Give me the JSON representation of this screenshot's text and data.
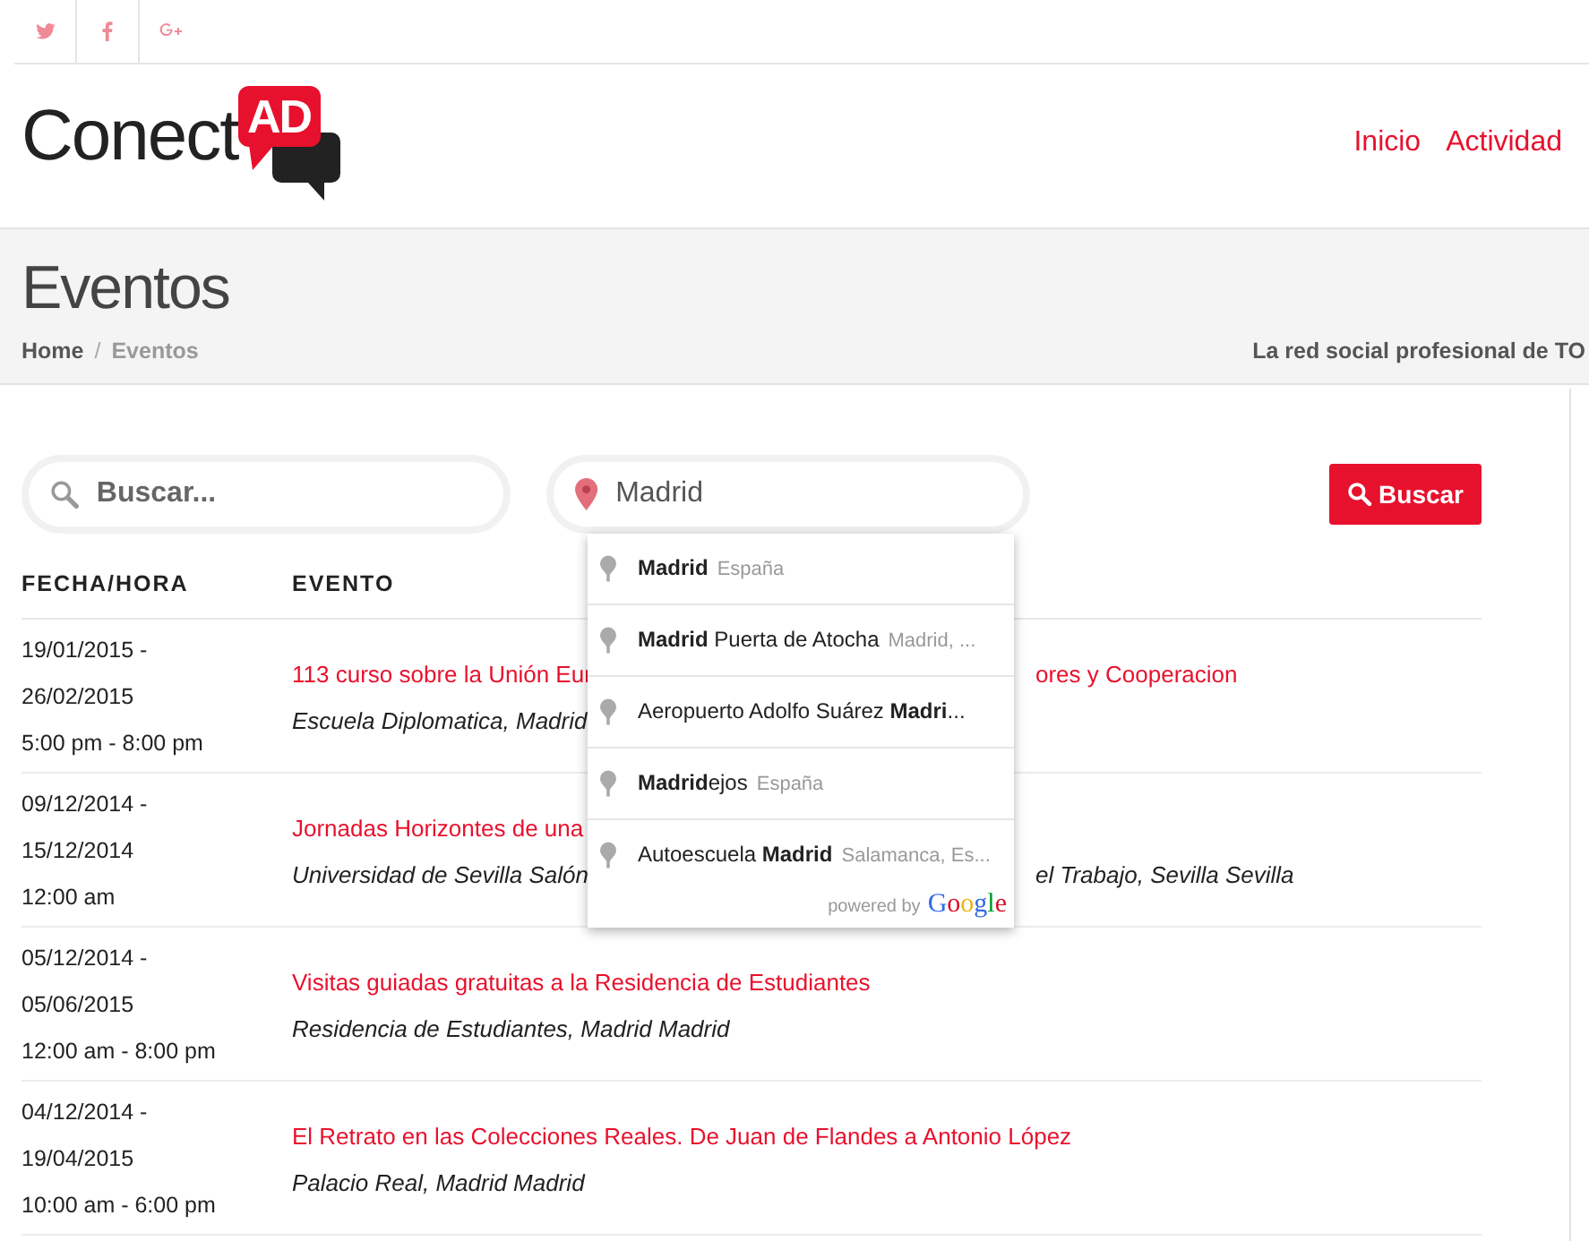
{
  "social": [
    {
      "kind": "twitter"
    },
    {
      "kind": "facebook"
    },
    {
      "kind": "googleplus"
    }
  ],
  "logo": {
    "text": "Conect",
    "badge": "AD"
  },
  "nav": [
    "Inicio",
    "Actividad"
  ],
  "page": {
    "title": "Eventos",
    "breadcrumb": [
      "Home",
      "Eventos"
    ],
    "breadcrumb_separator": "/",
    "tagline": "La red social profesional de TO"
  },
  "search": {
    "keyword_placeholder": "Buscar...",
    "location_value": "Madrid",
    "button": "Buscar"
  },
  "autocomplete": {
    "items": [
      {
        "main": "**Madrid**",
        "secondary": "España"
      },
      {
        "main": "**Madrid** Puerta de Atocha",
        "secondary": "Madrid, ..."
      },
      {
        "main": "Aeropuerto Adolfo Suárez **Madri**..."
      },
      {
        "main": "**Madrid**ejos",
        "secondary": "España"
      },
      {
        "main": "Autoescuela **Madrid**",
        "secondary": "Salamanca, Es..."
      }
    ],
    "powered_by": "powered by",
    "brand": "Google"
  },
  "table": {
    "columns": [
      "FECHA/HORA",
      "EVENTO"
    ],
    "rows": [
      {
        "dates": [
          "19/01/2015 -",
          "26/02/2015",
          "5:00 pm - 8:00 pm"
        ],
        "title": "113 curso sobre la Unión Eur",
        "title_tail": "ores y Cooperacion",
        "venue": "Escuela Diplomatica, Madrid"
      },
      {
        "dates": [
          "09/12/2014 -",
          "15/12/2014",
          "12:00 am"
        ],
        "title": "Jornadas Horizontes de una",
        "venue": "Universidad de Sevilla Salón",
        "venue_tail": "el Trabajo, Sevilla Sevilla"
      },
      {
        "dates": [
          "05/12/2014 -",
          "05/06/2015",
          "12:00 am - 8:00 pm"
        ],
        "title": "Visitas guiadas gratuitas a la Residencia de Estudiantes",
        "venue": "Residencia de Estudiantes, Madrid Madrid"
      },
      {
        "dates": [
          "04/12/2014 -",
          "19/04/2015",
          "10:00 am - 6:00 pm"
        ],
        "title": "El Retrato en las Colecciones Reales. De Juan de Flandes a Antonio López",
        "venue": "Palacio Real, Madrid Madrid"
      }
    ]
  }
}
